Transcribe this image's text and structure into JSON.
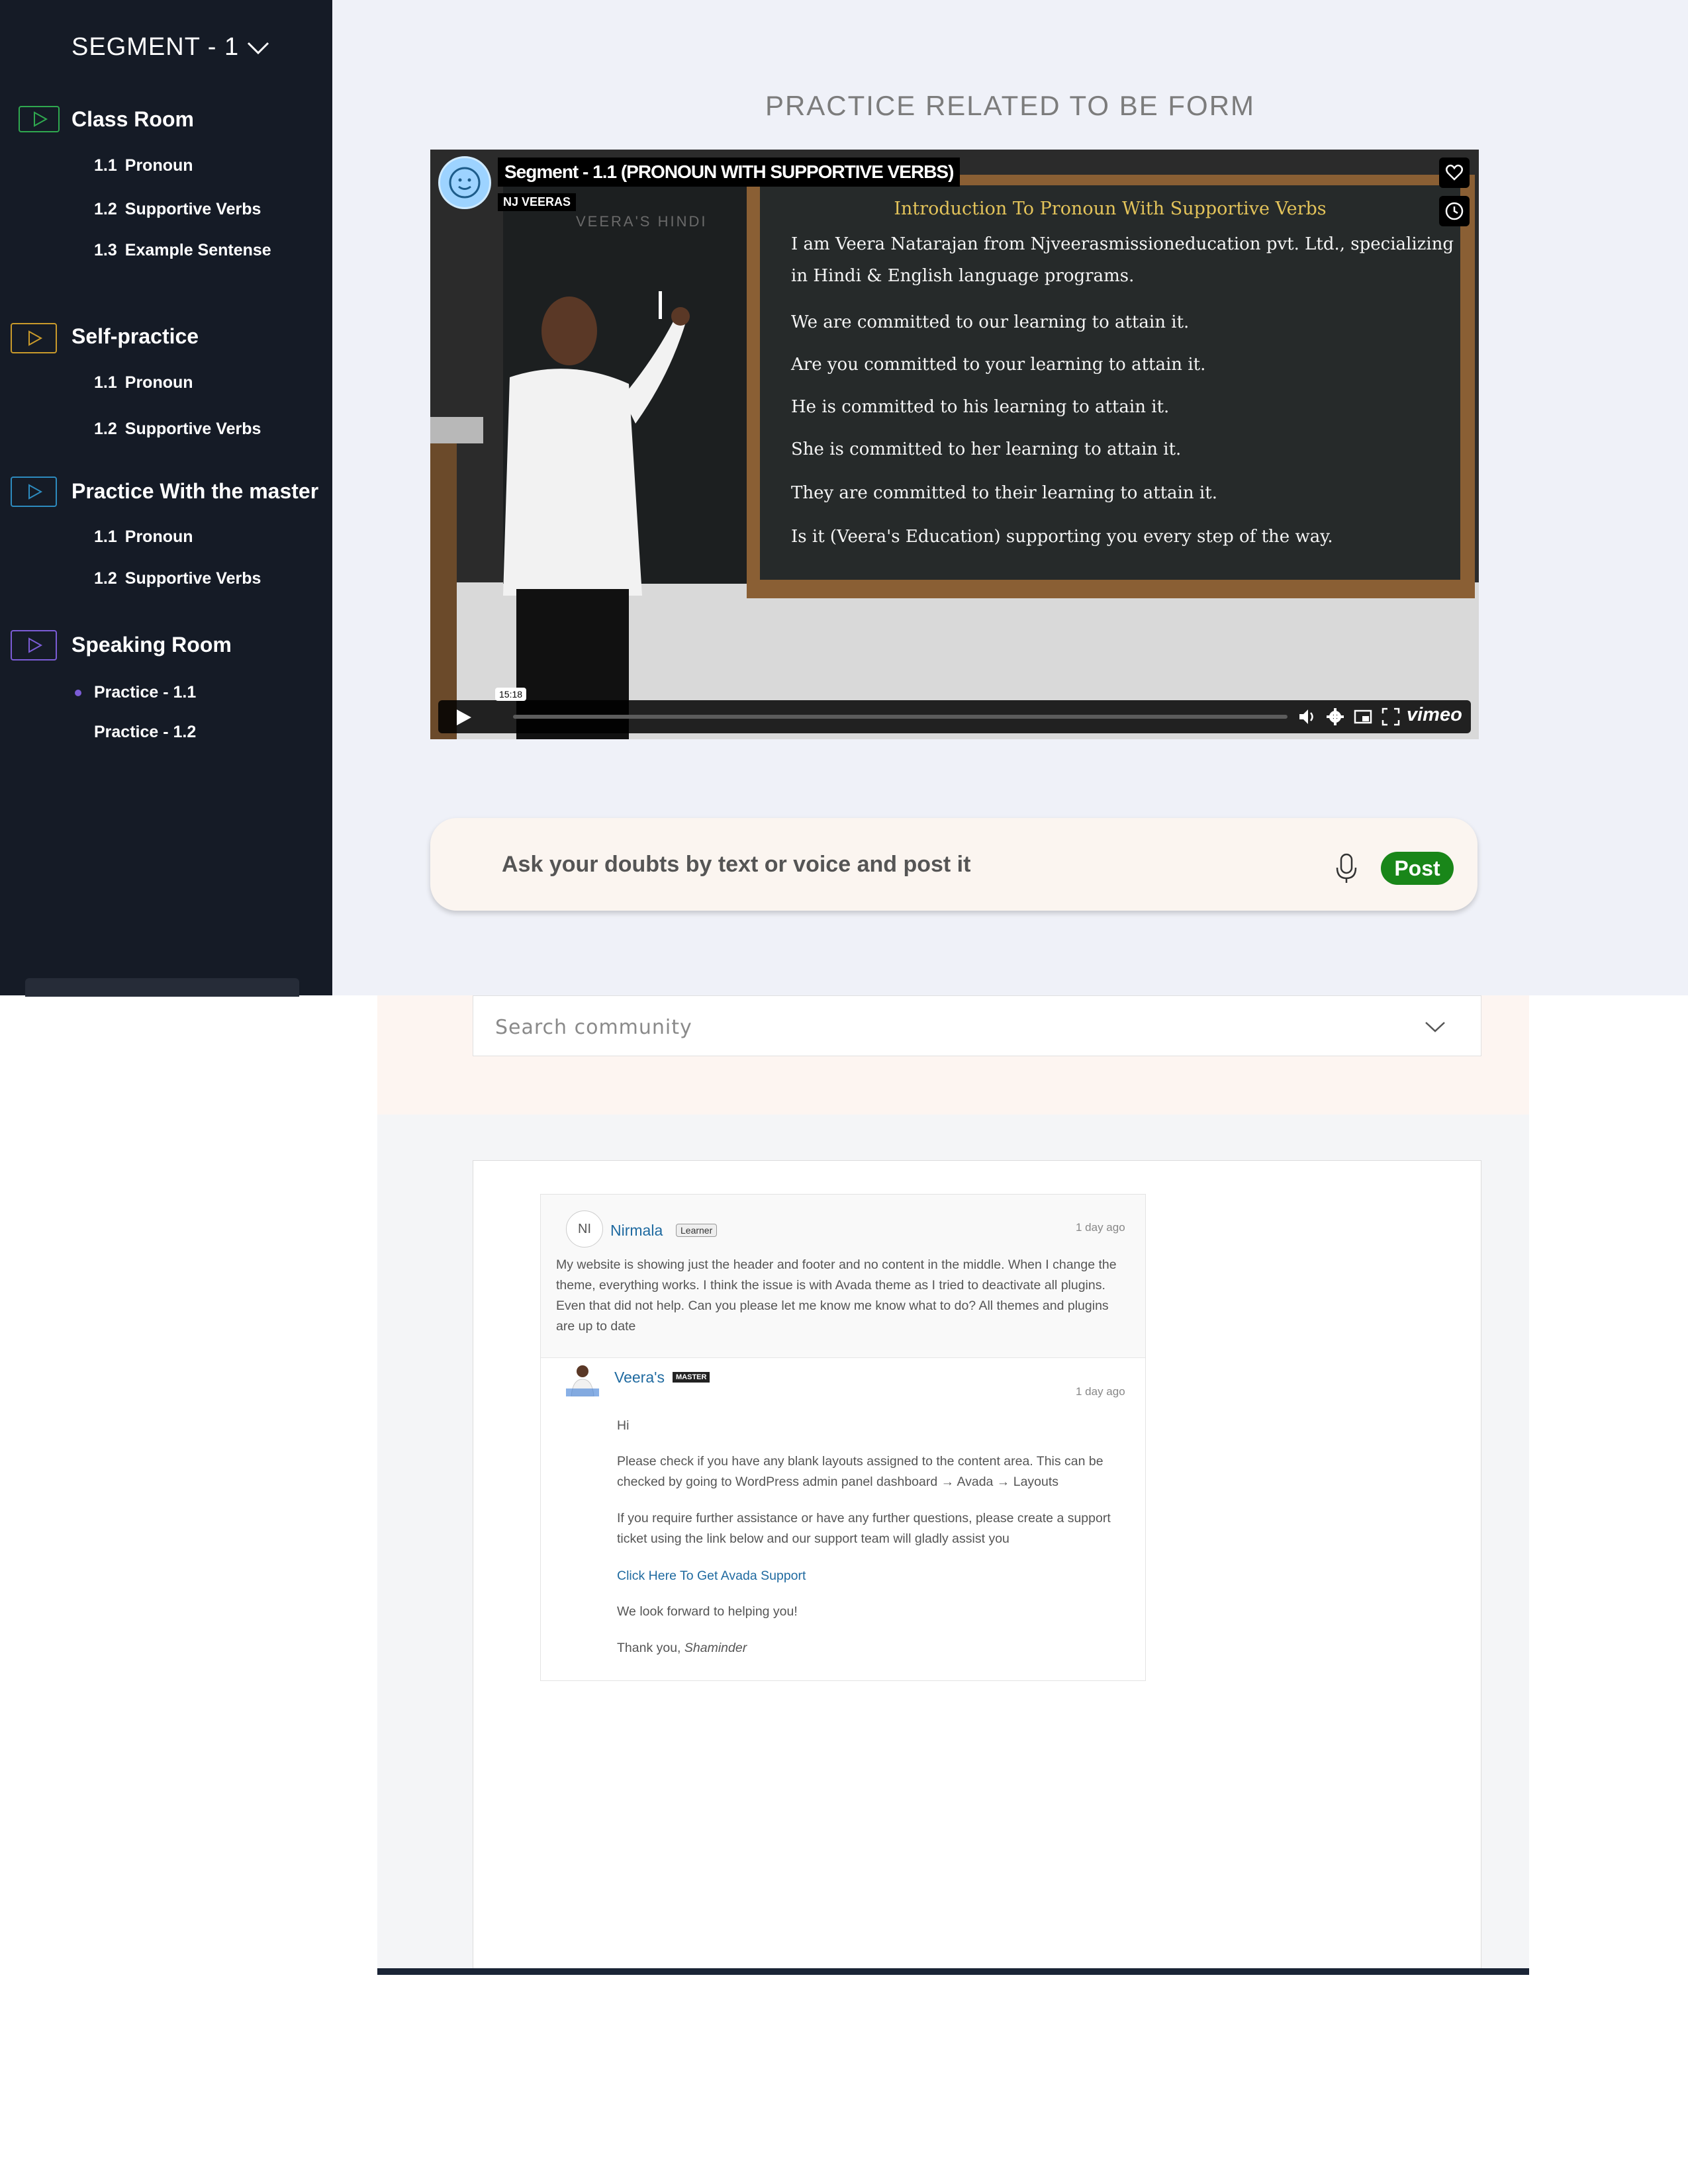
{
  "sidebar": {
    "segment_title": "SEGMENT - 1",
    "sections": [
      {
        "title": "Class Room",
        "color": "#2fa84f",
        "items": [
          {
            "num": "1.1",
            "label": "Pronoun"
          },
          {
            "num": "1.2",
            "label": "Supportive Verbs"
          },
          {
            "num": "1.3",
            "label": "Example Sentense"
          }
        ]
      },
      {
        "title": "Self-practice",
        "color": "#c99a2b",
        "items": [
          {
            "num": "1.1",
            "label": "Pronoun"
          },
          {
            "num": "1.2",
            "label": "Supportive Verbs"
          }
        ]
      },
      {
        "title": "Practice With the master",
        "color": "#2d8bbf",
        "items": [
          {
            "num": "1.1",
            "label": "Pronoun"
          },
          {
            "num": "1.2",
            "label": "Supportive Verbs"
          }
        ]
      },
      {
        "title": "Speaking Room",
        "color": "#7b5cd6",
        "items": [
          {
            "label": "Practice - 1.1"
          },
          {
            "label": "Practice - 1.2"
          }
        ]
      }
    ]
  },
  "main": {
    "page_title": "PRACTICE RELATED TO BE FORM",
    "video": {
      "title": "Segment - 1.1 (PRONOUN WITH SUPPORTIVE VERBS)",
      "author": "NJ VEERAS",
      "board_left_label": "VEERA'S HINDI",
      "board_heading": "Introduction To Pronoun With Supportive Verbs",
      "board_lines": [
        "I am Veera Natarajan from Njveerasmissioneducation pvt. Ltd., specializing",
        "in Hindi & English language programs.",
        "We are committed to our learning to attain it.",
        "Are you committed to your learning to attain it.",
        "He is committed to his learning to attain it.",
        "She is committed to her learning to attain it.",
        "They are committed to their learning to attain it.",
        "Is it (Veera's Education) supporting you every step of the way."
      ],
      "time_badge": "15:18",
      "brand": "vimeo"
    },
    "doubt": {
      "placeholder": "Ask your doubts by text or voice and post it",
      "post_label": "Post"
    }
  },
  "community": {
    "search_placeholder": "Search community",
    "question": {
      "avatar_initials": "NI",
      "author": "Nirmala",
      "badge": "Learner",
      "time": "1 day ago",
      "body": "My website is showing just the header and footer and no content in the middle. When I change the theme, everything works. I think the issue is with Avada theme as I tried to deactivate all plugins. Even that did not help. Can you please let me know me know what to do? All themes and plugins are up to date"
    },
    "answer": {
      "author": "Veera's",
      "badge": "MASTER",
      "time": "1 day ago",
      "greeting": "Hi",
      "p1": "Please check if you have any blank layouts assigned to the content area. This can be checked by going to WordPress admin panel dashboard → Avada → Layouts",
      "p2": "If you require further assistance or have any further questions, please create a support ticket using the link below and our support team will gladly assist you",
      "link": "Click Here To Get Avada Support",
      "p3": "We look forward to helping you!",
      "thanks": "Thank you,",
      "signature": "Shaminder"
    }
  }
}
